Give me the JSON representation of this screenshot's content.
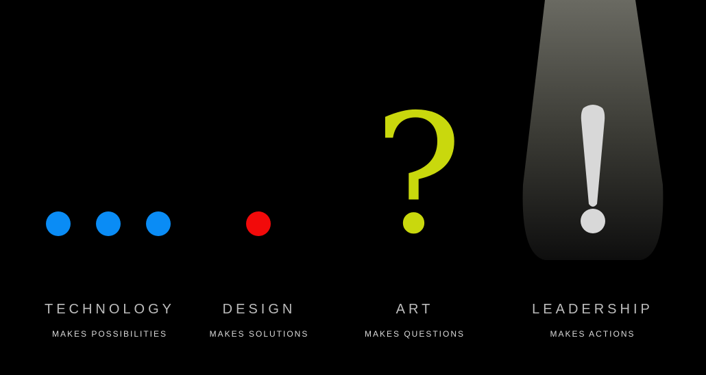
{
  "colors": {
    "background": "#000000",
    "technology_dots": "#0a8cf5",
    "design_dot": "#f20a0a",
    "art_question": "#c9d80d",
    "leadership_exclamation": "#d8d8d8"
  },
  "icons": {
    "technology": "three-blue-dots-icon",
    "design": "red-dot-icon",
    "art": "question-mark-icon",
    "leadership": "exclamation-mark-icon"
  },
  "glyphs": {
    "question": "?",
    "exclamation": "!"
  },
  "columns": [
    {
      "title": "TECHNOLOGY",
      "subtitle": "MAKES POSSIBILITIES"
    },
    {
      "title": "DESIGN",
      "subtitle": "MAKES SOLUTIONS"
    },
    {
      "title": "ART",
      "subtitle": "MAKES QUESTIONS"
    },
    {
      "title": "LEADERSHIP",
      "subtitle": "MAKES ACTIONS"
    }
  ]
}
